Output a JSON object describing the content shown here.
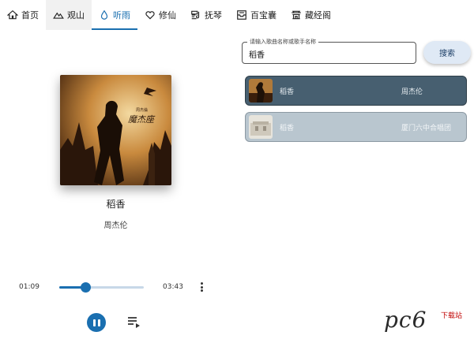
{
  "tabs": [
    {
      "label": "首页",
      "icon": "home-icon"
    },
    {
      "label": "观山",
      "icon": "mountain-icon"
    },
    {
      "label": "听雨",
      "icon": "water-drop-icon",
      "active": true
    },
    {
      "label": "修仙",
      "icon": "heart-icon"
    },
    {
      "label": "抚琴",
      "icon": "music-note-icon"
    },
    {
      "label": "百宝囊",
      "icon": "inbox-icon"
    },
    {
      "label": "藏经阁",
      "icon": "temple-icon"
    }
  ],
  "now_playing": {
    "title": "稻香",
    "artist": "周杰伦",
    "cover_text": "魔杰座",
    "cover_small_text": "周杰倫"
  },
  "player": {
    "current_time": "01:09",
    "total_time": "03:43",
    "progress": 0.31,
    "play_state_icon": "pause-icon",
    "more_icon": "more-vert-icon",
    "queue_icon": "playlist-play-icon",
    "accent_color": "#1a6fb0"
  },
  "search": {
    "label": "请输入歌曲名称或歌手名称",
    "value": "稻香",
    "button_label": "搜索"
  },
  "results": [
    {
      "title": "稻香",
      "artist": "周杰伦",
      "selected": true
    },
    {
      "title": "稻香",
      "artist": "厦门六中合唱团",
      "selected": false
    }
  ],
  "watermark": {
    "text": "pc6",
    "sub": "下载站"
  }
}
